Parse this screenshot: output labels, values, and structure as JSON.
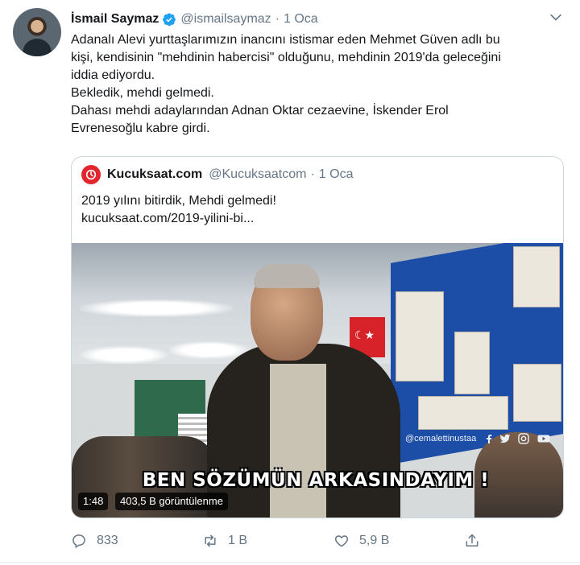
{
  "tweet": {
    "author_name": "İsmail Saymaz",
    "handle": "@ismailsaymaz",
    "separator": "·",
    "time": "1 Oca",
    "text_lines": [
      "Adanalı Alevi yurttaşlarımızın inancını istismar eden Mehmet Güven adlı bu",
      "kişi, kendisinin \"mehdinin habercisi\" olduğunu, mehdinin 2019'da geleceğini",
      "iddia ediyordu.",
      "Bekledik, mehdi gelmedi.",
      "Dahası mehdi adaylarından Adnan Oktar cezaevine, İskender Erol",
      "Evrenesoğlu kabre girdi."
    ]
  },
  "quoted": {
    "name": "Kucuksaat.com",
    "handle": "@Kucuksaatcom",
    "separator": "·",
    "time": "1 Oca",
    "text": "2019 yılını bitirdik, Mehdi gelmedi!",
    "link": "kucuksaat.com/2019-yilini-bi...",
    "media": {
      "subtitle": "BEN SÖZÜMÜN ARKASINDAYIM !",
      "watermark": "@cemalettinustaa",
      "duration": "1:48",
      "views": "403,5 B görüntülenme"
    }
  },
  "actions": {
    "reply_count": "833",
    "retweet_count": "1 B",
    "like_count": "5,9 B"
  },
  "icons": {
    "verified": "verified-badge-icon",
    "caret": "chevron-down-icon",
    "reply": "reply-icon",
    "retweet": "retweet-icon",
    "like": "heart-icon",
    "share": "share-icon"
  },
  "colors": {
    "verified_blue": "#1da1f2",
    "secondary_text": "#657786",
    "brand_red": "#e3262d"
  }
}
